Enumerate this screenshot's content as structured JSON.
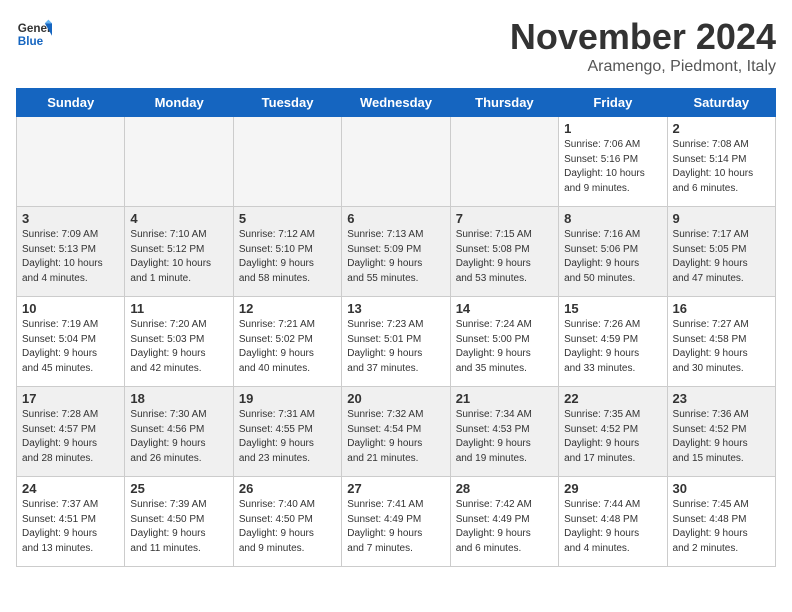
{
  "header": {
    "logo_line1": "General",
    "logo_line2": "Blue",
    "month": "November 2024",
    "location": "Aramengo, Piedmont, Italy"
  },
  "days_of_week": [
    "Sunday",
    "Monday",
    "Tuesday",
    "Wednesday",
    "Thursday",
    "Friday",
    "Saturday"
  ],
  "weeks": [
    {
      "shade": false,
      "days": [
        {
          "num": "",
          "info": ""
        },
        {
          "num": "",
          "info": ""
        },
        {
          "num": "",
          "info": ""
        },
        {
          "num": "",
          "info": ""
        },
        {
          "num": "",
          "info": ""
        },
        {
          "num": "1",
          "info": "Sunrise: 7:06 AM\nSunset: 5:16 PM\nDaylight: 10 hours\nand 9 minutes."
        },
        {
          "num": "2",
          "info": "Sunrise: 7:08 AM\nSunset: 5:14 PM\nDaylight: 10 hours\nand 6 minutes."
        }
      ]
    },
    {
      "shade": true,
      "days": [
        {
          "num": "3",
          "info": "Sunrise: 7:09 AM\nSunset: 5:13 PM\nDaylight: 10 hours\nand 4 minutes."
        },
        {
          "num": "4",
          "info": "Sunrise: 7:10 AM\nSunset: 5:12 PM\nDaylight: 10 hours\nand 1 minute."
        },
        {
          "num": "5",
          "info": "Sunrise: 7:12 AM\nSunset: 5:10 PM\nDaylight: 9 hours\nand 58 minutes."
        },
        {
          "num": "6",
          "info": "Sunrise: 7:13 AM\nSunset: 5:09 PM\nDaylight: 9 hours\nand 55 minutes."
        },
        {
          "num": "7",
          "info": "Sunrise: 7:15 AM\nSunset: 5:08 PM\nDaylight: 9 hours\nand 53 minutes."
        },
        {
          "num": "8",
          "info": "Sunrise: 7:16 AM\nSunset: 5:06 PM\nDaylight: 9 hours\nand 50 minutes."
        },
        {
          "num": "9",
          "info": "Sunrise: 7:17 AM\nSunset: 5:05 PM\nDaylight: 9 hours\nand 47 minutes."
        }
      ]
    },
    {
      "shade": false,
      "days": [
        {
          "num": "10",
          "info": "Sunrise: 7:19 AM\nSunset: 5:04 PM\nDaylight: 9 hours\nand 45 minutes."
        },
        {
          "num": "11",
          "info": "Sunrise: 7:20 AM\nSunset: 5:03 PM\nDaylight: 9 hours\nand 42 minutes."
        },
        {
          "num": "12",
          "info": "Sunrise: 7:21 AM\nSunset: 5:02 PM\nDaylight: 9 hours\nand 40 minutes."
        },
        {
          "num": "13",
          "info": "Sunrise: 7:23 AM\nSunset: 5:01 PM\nDaylight: 9 hours\nand 37 minutes."
        },
        {
          "num": "14",
          "info": "Sunrise: 7:24 AM\nSunset: 5:00 PM\nDaylight: 9 hours\nand 35 minutes."
        },
        {
          "num": "15",
          "info": "Sunrise: 7:26 AM\nSunset: 4:59 PM\nDaylight: 9 hours\nand 33 minutes."
        },
        {
          "num": "16",
          "info": "Sunrise: 7:27 AM\nSunset: 4:58 PM\nDaylight: 9 hours\nand 30 minutes."
        }
      ]
    },
    {
      "shade": true,
      "days": [
        {
          "num": "17",
          "info": "Sunrise: 7:28 AM\nSunset: 4:57 PM\nDaylight: 9 hours\nand 28 minutes."
        },
        {
          "num": "18",
          "info": "Sunrise: 7:30 AM\nSunset: 4:56 PM\nDaylight: 9 hours\nand 26 minutes."
        },
        {
          "num": "19",
          "info": "Sunrise: 7:31 AM\nSunset: 4:55 PM\nDaylight: 9 hours\nand 23 minutes."
        },
        {
          "num": "20",
          "info": "Sunrise: 7:32 AM\nSunset: 4:54 PM\nDaylight: 9 hours\nand 21 minutes."
        },
        {
          "num": "21",
          "info": "Sunrise: 7:34 AM\nSunset: 4:53 PM\nDaylight: 9 hours\nand 19 minutes."
        },
        {
          "num": "22",
          "info": "Sunrise: 7:35 AM\nSunset: 4:52 PM\nDaylight: 9 hours\nand 17 minutes."
        },
        {
          "num": "23",
          "info": "Sunrise: 7:36 AM\nSunset: 4:52 PM\nDaylight: 9 hours\nand 15 minutes."
        }
      ]
    },
    {
      "shade": false,
      "days": [
        {
          "num": "24",
          "info": "Sunrise: 7:37 AM\nSunset: 4:51 PM\nDaylight: 9 hours\nand 13 minutes."
        },
        {
          "num": "25",
          "info": "Sunrise: 7:39 AM\nSunset: 4:50 PM\nDaylight: 9 hours\nand 11 minutes."
        },
        {
          "num": "26",
          "info": "Sunrise: 7:40 AM\nSunset: 4:50 PM\nDaylight: 9 hours\nand 9 minutes."
        },
        {
          "num": "27",
          "info": "Sunrise: 7:41 AM\nSunset: 4:49 PM\nDaylight: 9 hours\nand 7 minutes."
        },
        {
          "num": "28",
          "info": "Sunrise: 7:42 AM\nSunset: 4:49 PM\nDaylight: 9 hours\nand 6 minutes."
        },
        {
          "num": "29",
          "info": "Sunrise: 7:44 AM\nSunset: 4:48 PM\nDaylight: 9 hours\nand 4 minutes."
        },
        {
          "num": "30",
          "info": "Sunrise: 7:45 AM\nSunset: 4:48 PM\nDaylight: 9 hours\nand 2 minutes."
        }
      ]
    }
  ]
}
